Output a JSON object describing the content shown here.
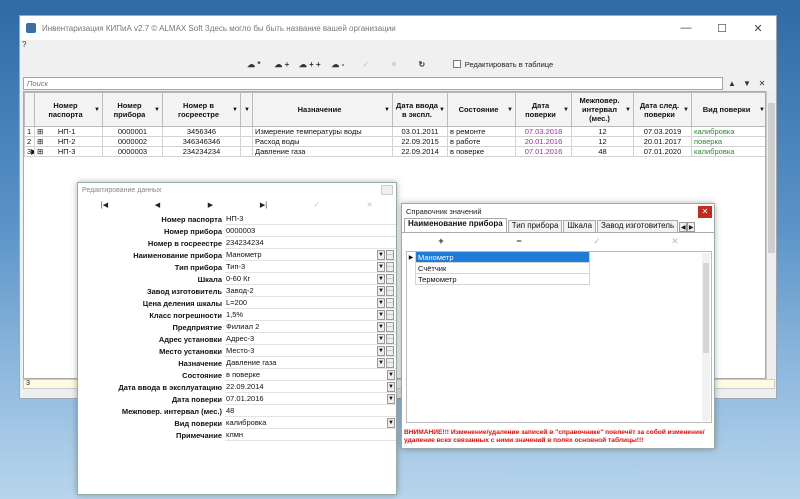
{
  "window": {
    "title": "Инвентаризация КИПиА v2.7   © ALMAX Soft   Здесь могло бы быть название вашей организации",
    "menu": "?",
    "minimize": "—",
    "maximize": "☐",
    "close": "✕"
  },
  "toolbar": {
    "buttons": [
      "☁ *",
      "☁ +",
      "☁ + +",
      "☁ -",
      "✓",
      "✕",
      "↻"
    ],
    "edit_in_table_label": "Редактировать в таблице"
  },
  "search": {
    "placeholder": "Поиск",
    "btn_up": "▲",
    "btn_down": "▼",
    "btn_clear": "✕"
  },
  "grid": {
    "columns": [
      "",
      "Номер паспорта",
      "Номер прибора",
      "Номер в госреестре",
      "",
      "Назначение",
      "Дата ввода в экспл.",
      "Состояние",
      "Дата поверки",
      "Межповер. интервал (мес.)",
      "Дата след. поверки",
      "Вид поверки"
    ],
    "rows": [
      {
        "n": "1",
        "marker": "",
        "passport": "НП-1",
        "device": "0000001",
        "reg": "3456346",
        "purpose": "Измерение температуры воды",
        "date_in": "03.01.2011",
        "state": "в ремонте",
        "check_date": "07.03.2018",
        "interval": "12",
        "next_date": "07.03.2019",
        "check_type": "калибровка"
      },
      {
        "n": "2",
        "marker": "",
        "passport": "НП-2",
        "device": "0000002",
        "reg": "346346346",
        "purpose": "Расход воды",
        "date_in": "22.09.2015",
        "state": "в работе",
        "check_date": "20.01.2016",
        "interval": "12",
        "next_date": "20.01.2017",
        "check_type": "поверка"
      },
      {
        "n": "3",
        "marker": "▶",
        "passport": "НП-3",
        "device": "0000003",
        "reg": "234234234",
        "purpose": "Давление газа",
        "date_in": "22.09.2014",
        "state": "в поверке",
        "check_date": "07.01.2016",
        "interval": "48",
        "next_date": "07.01.2020",
        "check_type": "калибровка"
      }
    ],
    "record_count": "3"
  },
  "edit_window": {
    "title": "Редактирование данных",
    "nav": [
      "|◀",
      "◀",
      "▶",
      "▶|",
      "✓",
      "✕"
    ],
    "fields": [
      {
        "label": "Номер паспорта",
        "value": "НП-3",
        "dd": false
      },
      {
        "label": "Номер прибора",
        "value": "0000003",
        "dd": false
      },
      {
        "label": "Номер в госреестре",
        "value": "234234234",
        "dd": false
      },
      {
        "label": "Наименование прибора",
        "value": "Манометр",
        "dd": true,
        "ell": true
      },
      {
        "label": "Тип прибора",
        "value": "Тип-3",
        "dd": true,
        "ell": true
      },
      {
        "label": "Шкала",
        "value": "0-60 Кг",
        "dd": true,
        "ell": true
      },
      {
        "label": "Завод изготовитель",
        "value": "Завод-2",
        "dd": true,
        "ell": true
      },
      {
        "label": "Цена деления шкалы",
        "value": "L=200",
        "dd": true,
        "ell": true
      },
      {
        "label": "Класс погрешности",
        "value": "1,5%",
        "dd": true,
        "ell": true
      },
      {
        "label": "Предприятие",
        "value": "Филиал 2",
        "dd": true,
        "ell": true
      },
      {
        "label": "Адрес установки",
        "value": "Адрес-3",
        "dd": true,
        "ell": true
      },
      {
        "label": "Место установки",
        "value": "Место-3",
        "dd": true,
        "ell": true
      },
      {
        "label": "Назначение",
        "value": "Давление газа",
        "dd": true,
        "ell": true
      },
      {
        "label": "Состояние",
        "value": "в поверке",
        "dd": true,
        "ell": false
      },
      {
        "label": "Дата ввода в эксплуатацию",
        "value": "22.09.2014",
        "dd": true,
        "ell": false
      },
      {
        "label": "Дата поверки",
        "value": "07.01.2016",
        "dd": true,
        "ell": false
      },
      {
        "label": "Межповер. интервал (мес.)",
        "value": "48",
        "dd": false
      },
      {
        "label": "Вид поверки",
        "value": "калибровка",
        "dd": true,
        "ell": false
      },
      {
        "label": "Примечание",
        "value": "клмн",
        "dd": false
      }
    ]
  },
  "ref_window": {
    "title": "Справочник значений",
    "close": "✕",
    "tabs": [
      "Наименование прибора",
      "Тип прибора",
      "Шкала",
      "Завод изготовитель"
    ],
    "tab_prev": "◀",
    "tab_next": "▶",
    "toolbar": [
      "+",
      "−",
      "✓",
      "✕"
    ],
    "items": [
      "Манометр",
      "Счётчик",
      "Термометр"
    ],
    "warning": "ВНИМАНИЕ!!! Изменение/удаление записей в \"справочнике\" повлечёт за собой изменение/удаление всех связанных с ними значений в полях основной таблицы!!!"
  },
  "colors": {
    "selection": "#1f7ad8",
    "purple_date": "#9b2f9b",
    "green_type": "#2a8a2a",
    "warning_red": "#d11111"
  }
}
